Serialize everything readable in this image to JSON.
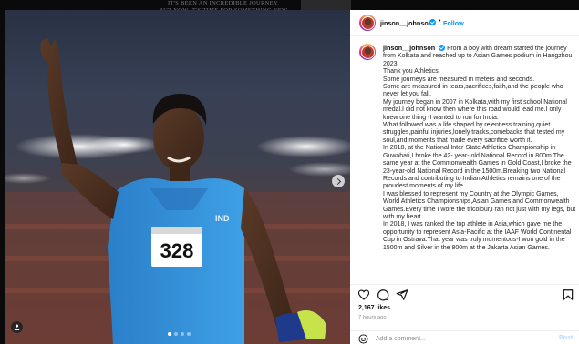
{
  "backdrop": {
    "line1": "IT'S BEEN AN INCREDIBLE JOURNEY,",
    "line2": "BUT NOW IT'S TIME FOR SOMETHING NEW"
  },
  "post": {
    "username": "jinson__johnson",
    "follow_label": "Follow",
    "separator": "•",
    "caption_lines": [
      "From a boy with dream started the journey from Kolkata and reached up to Asian Games podium in Hangzhou 2023.",
      "Thank you Athletics.",
      "Some journeys are measured in meters and seconds.",
      "Some are measured in tears,sacrifices,faith,and the people who never let you fall.",
      "My journey began in 2007 in Kolkata,with my first school National medal.I did not know then where this road would lead me.I only knew one thing -I wanted to run for India.",
      "What followed was a life shaped by relentless training,quiet struggles,painful injuries,lonely tracks,comebacks that tested my soul,and moments that made every sacrifice worth it.",
      "In 2018, at the National Inter-State Athletics Championship in Guwahati,I broke the 42- year- old National Record in 800m.The same year at the Commonwealth Games in Gold Coast,I broke the 23-year-old National Record in the 1500m.Breaking two National Records and contributing to Indian Athletics remains one of the proudest moments of my life.",
      "I was blessed to represent my Country at the Olympic Games, World Athletics Championships,Asian Games,and Commonwealth Games.Every time I wore the tricolour,I ran not just with my legs, but with my heart.",
      "In 2018, I was ranked the top athlete in Asia,which gave me the opportunity to represent Asia-Pacific at the IAAF World Continental Cup in Ostrava.That year was truly momentous-I won gold in the 1500m and Silver in the 800m at the Jakarta Asian Games."
    ],
    "likes": "2,167 likes",
    "time_ago": "7 hours ago",
    "comment_placeholder": "Add a comment...",
    "post_label": "Post"
  },
  "photo": {
    "bib_number": "328",
    "bib_label": "IND",
    "carousel_dots": 4,
    "active_dot": 1
  },
  "colors": {
    "accent": "#0095f6",
    "jersey": "#2b7fc9"
  }
}
